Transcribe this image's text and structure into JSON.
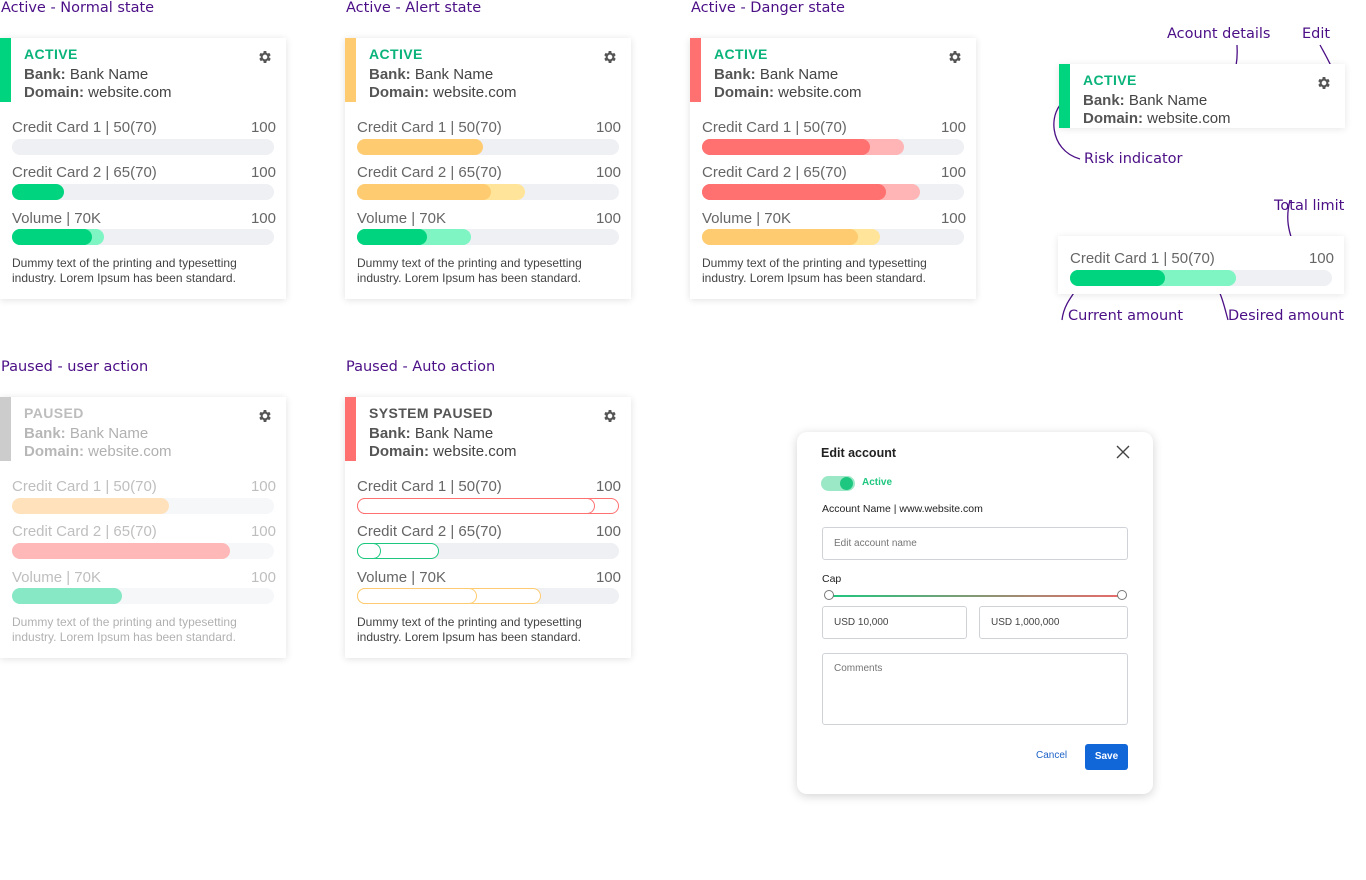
{
  "headings": {
    "normal": "Active - Normal state",
    "alert": "Active - Alert state",
    "danger": "Active - Danger state",
    "paused_user": "Paused - user action",
    "paused_auto": "Paused - Auto action"
  },
  "colors": {
    "green": "#00d47f",
    "green_light": "#7ef5c3",
    "yellow": "#ffcb70",
    "yellow_light": "#ffe49a",
    "red": "#ff7070",
    "red_light": "#ffb5b5",
    "grey": "#cccccc",
    "purple": "#4b0f86"
  },
  "cards": {
    "normal": {
      "status": "ACTIVE",
      "bank_label": "Bank:",
      "bank_value": "Bank Name",
      "domain_label": "Domain:",
      "domain_value": "website.com",
      "rows": [
        {
          "label": "Credit Card 1 | 50(70)",
          "max": "100",
          "current": 50,
          "desired": 70
        },
        {
          "label": "Credit Card 2 | 65(70)",
          "max": "100",
          "current": 65,
          "desired": 70
        },
        {
          "label": "Volume | 70K",
          "max": "100",
          "current": 70,
          "desired": 70
        }
      ],
      "description": "Dummy text of the printing and typesetting industry. Lorem Ipsum has been standard."
    },
    "alert": {
      "status": "ACTIVE",
      "bank_label": "Bank:",
      "bank_value": "Bank Name",
      "domain_label": "Domain:",
      "domain_value": "website.com",
      "rows": [
        {
          "label": "Credit Card 1 | 50(70)",
          "max": "100",
          "current": 50,
          "desired": 70
        },
        {
          "label": "Credit Card 2 | 65(70)",
          "max": "100",
          "current": 65,
          "desired": 70
        },
        {
          "label": "Volume | 70K",
          "max": "100",
          "current": 70,
          "desired": 70
        }
      ],
      "description": "Dummy text of the printing and typesetting industry. Lorem Ipsum has been standard."
    },
    "danger": {
      "status": "ACTIVE",
      "bank_label": "Bank:",
      "bank_value": "Bank Name",
      "domain_label": "Domain:",
      "domain_value": "website.com",
      "rows": [
        {
          "label": "Credit Card 1 | 50(70)",
          "max": "100",
          "current": 50,
          "desired": 70
        },
        {
          "label": "Credit Card 2 | 65(70)",
          "max": "100",
          "current": 65,
          "desired": 70
        },
        {
          "label": "Volume | 70K",
          "max": "100",
          "current": 70,
          "desired": 70
        }
      ],
      "description": "Dummy text of the printing and typesetting industry. Lorem Ipsum has been standard."
    },
    "paused_user": {
      "status": "PAUSED",
      "bank_label": "Bank:",
      "bank_value": "Bank Name",
      "domain_label": "Domain:",
      "domain_value": "website.com",
      "rows": [
        {
          "label": "Credit Card 1 | 50(70)",
          "max": "100",
          "current": 50,
          "desired": 70
        },
        {
          "label": "Credit Card 2 | 65(70)",
          "max": "100",
          "current": 65,
          "desired": 70
        },
        {
          "label": "Volume | 70K",
          "max": "100",
          "current": 70,
          "desired": 70
        }
      ],
      "description": "Dummy text of the printing and typesetting industry. Lorem Ipsum has been standard."
    },
    "paused_auto": {
      "status": "SYSTEM PAUSED",
      "bank_label": "Bank:",
      "bank_value": "Bank Name",
      "domain_label": "Domain:",
      "domain_value": "website.com",
      "rows": [
        {
          "label": "Credit Card 1 | 50(70)",
          "max": "100",
          "current": 50,
          "desired": 70
        },
        {
          "label": "Credit Card 2 | 65(70)",
          "max": "100",
          "current": 65,
          "desired": 70
        },
        {
          "label": "Volume | 70K",
          "max": "100",
          "current": 70,
          "desired": 70
        }
      ],
      "description": "Dummy text of the printing and typesetting industry. Lorem Ipsum has been standard."
    }
  },
  "legend": {
    "account_details": "Acount details",
    "edit": "Edit",
    "risk_indicator": "Risk indicator",
    "total_limit": "Total limit",
    "current_amount": "Current amount",
    "desired_amount": "Desired amount",
    "card": {
      "status": "ACTIVE",
      "bank_label": "Bank:",
      "bank_value": "Bank Name",
      "domain_label": "Domain:",
      "domain_value": "website.com"
    },
    "row": {
      "label": "Credit Card 1 | 50(70)",
      "max": "100",
      "current": 50,
      "desired": 70
    }
  },
  "modal": {
    "title": "Edit account",
    "toggle_label": "Active",
    "toggle_on": true,
    "account_line": "Account Name | www.website.com",
    "name_placeholder": "Edit account name",
    "cap_label": "Cap",
    "cap_min_value": "USD 10,000",
    "cap_max_value": "USD 1,000,000",
    "comments_placeholder": "Comments",
    "cancel_label": "Cancel",
    "save_label": "Save"
  }
}
